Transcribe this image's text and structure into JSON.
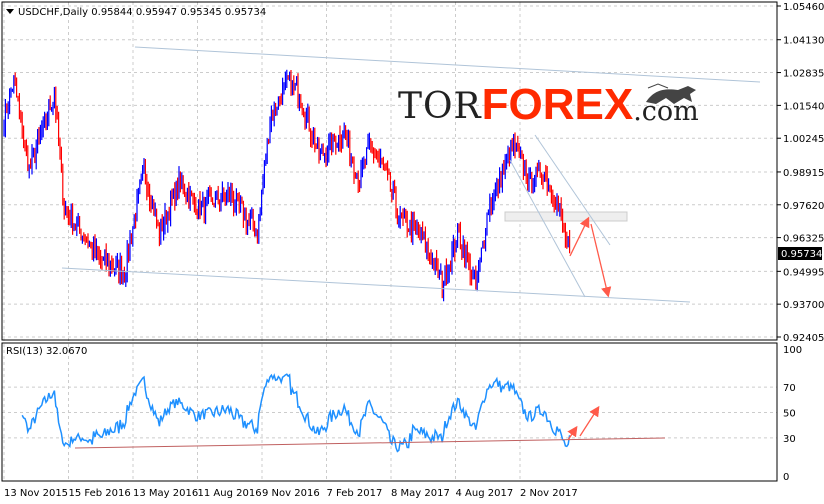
{
  "header": {
    "symbol": "USDCHF,Daily",
    "open": "0.95844",
    "high": "0.95947",
    "low": "0.95345",
    "close": "0.95734"
  },
  "logo": {
    "part1": "TOR",
    "part2": "FOREX",
    ".com": ".com",
    "part3": ".com"
  },
  "colors": {
    "up": "#0000ff",
    "down": "#ff0000",
    "channel": "#b0c4d8",
    "arrow": "#ff5a4a",
    "rsi": "#1e90ff",
    "rsi_support": "#c06060"
  },
  "chart_data": [
    {
      "type": "line",
      "title": "USDCHF,Daily",
      "ylim": [
        0.92405,
        1.0546
      ],
      "yticks": [
        "1.05460",
        "1.04130",
        "1.02835",
        "1.01540",
        "1.00245",
        "0.98915",
        "0.97620",
        "0.96325",
        "0.94995",
        "0.93700",
        "0.92405"
      ],
      "current_price": "0.95734",
      "xticks": [
        "13 Nov 2015",
        "15 Feb 2016",
        "13 May 2016",
        "11 Aug 2016",
        "9 Nov 2016",
        "7 Feb 2017",
        "8 May 2017",
        "4 Aug 2017",
        "2 Nov 2017"
      ],
      "anchors": [
        [
          0,
          1.01
        ],
        [
          7,
          1.025
        ],
        [
          18,
          0.99
        ],
        [
          36,
          1.02
        ],
        [
          43,
          0.975
        ],
        [
          68,
          0.955
        ],
        [
          86,
          0.95
        ],
        [
          100,
          0.99
        ],
        [
          111,
          0.965
        ],
        [
          125,
          0.985
        ],
        [
          139,
          0.975
        ],
        [
          161,
          0.98
        ],
        [
          181,
          0.965
        ],
        [
          190,
          1.01
        ],
        [
          203,
          1.025
        ],
        [
          211,
          1.02
        ],
        [
          225,
          0.995
        ],
        [
          243,
          1.005
        ],
        [
          254,
          0.985
        ],
        [
          261,
          1.0
        ],
        [
          272,
          0.99
        ],
        [
          283,
          0.97
        ],
        [
          297,
          0.965
        ],
        [
          313,
          0.945
        ],
        [
          325,
          0.965
        ],
        [
          337,
          0.943
        ],
        [
          346,
          0.975
        ],
        [
          364,
          1.0
        ],
        [
          375,
          0.985
        ],
        [
          385,
          0.99
        ],
        [
          396,
          0.975
        ],
        [
          404,
          0.957
        ]
      ]
    },
    {
      "type": "line",
      "title": "RSI(13) 32.0670",
      "ylim": [
        0,
        100
      ],
      "yticks": [
        "100",
        "70",
        "50",
        "30",
        "0"
      ]
    }
  ]
}
